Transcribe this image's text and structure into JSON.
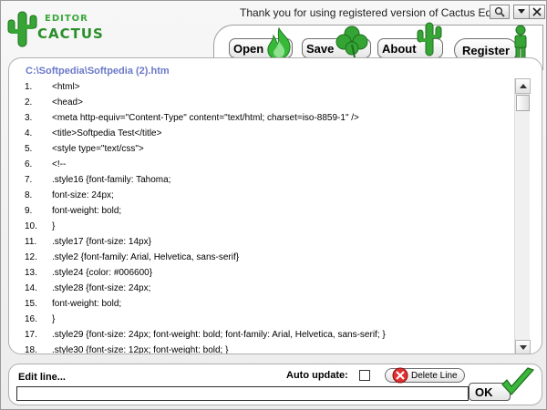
{
  "app": {
    "logo_top": "EDITOR",
    "logo_bottom": "CACTUS",
    "title": "Thank you for using registered version of Cactus Editor"
  },
  "toolbar": {
    "open_label": "Open",
    "save_label": "Save",
    "about_label": "About",
    "register_label": "Register"
  },
  "editor": {
    "file_path": "C:\\Softpedia\\Softpedia (2).htm",
    "lines": [
      {
        "num": "1.",
        "text": "<html>"
      },
      {
        "num": "2.",
        "text": "<head>"
      },
      {
        "num": "3.",
        "text": "<meta http-equiv=\"Content-Type\" content=\"text/html; charset=iso-8859-1\" />"
      },
      {
        "num": "4.",
        "text": "<title>Softpedia Test</title>"
      },
      {
        "num": "5.",
        "text": "<style type=\"text/css\">"
      },
      {
        "num": "6.",
        "text": "<!--"
      },
      {
        "num": "7.",
        "text": ".style16 {font-family: Tahoma;"
      },
      {
        "num": "8.",
        "text": "font-size: 24px;"
      },
      {
        "num": "9.",
        "text": "font-weight: bold;"
      },
      {
        "num": "10.",
        "text": "}"
      },
      {
        "num": "11.",
        "text": ".style17 {font-size: 14px}"
      },
      {
        "num": "12.",
        "text": ".style2 {font-family: Arial, Helvetica, sans-serif}"
      },
      {
        "num": "13.",
        "text": ".style24 {color: #006600}"
      },
      {
        "num": "14.",
        "text": ".style28 {font-size: 24px;"
      },
      {
        "num": "15.",
        "text": "font-weight: bold;"
      },
      {
        "num": "16.",
        "text": "}"
      },
      {
        "num": "17.",
        "text": ".style29 {font-size: 24px; font-weight: bold; font-family: Arial, Helvetica, sans-serif; }"
      },
      {
        "num": "18.",
        "text": ".style30 {font-size: 12px; font-weight: bold; }"
      }
    ]
  },
  "bottom": {
    "edit_line_label": "Edit line...",
    "edit_line_value": "",
    "auto_update_label": "Auto update:",
    "delete_line_label": "Delete Line",
    "ok_label": "OK"
  },
  "colors": {
    "path_color": "#6a79c8",
    "cactus_green": "#2f9e2f",
    "logo_green": "#3aa83a"
  },
  "icons": {
    "open": "green-flame-icon",
    "save": "clover-icon",
    "about": "cactus-icon",
    "register": "person-icon",
    "search": "search-icon",
    "dropdown": "chevron-down-icon",
    "close": "close-icon",
    "delete": "delete-x-icon",
    "ok": "checkmark-icon"
  }
}
